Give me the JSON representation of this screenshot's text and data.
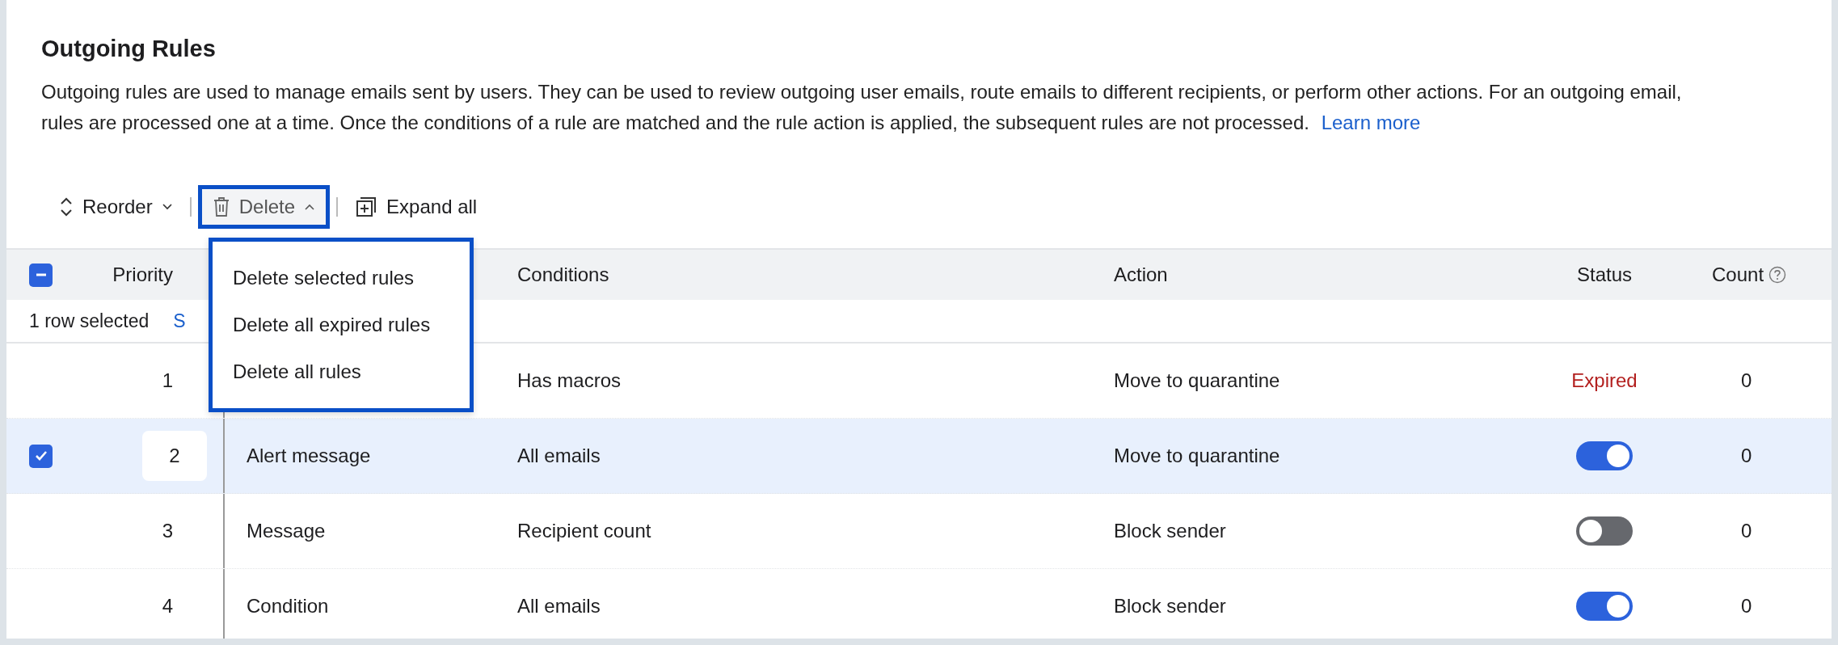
{
  "page": {
    "title": "Outgoing Rules",
    "description": "Outgoing rules are used to manage emails sent by users. They can be used to review outgoing user emails, route emails to different recipients, or perform other actions. For an outgoing email, rules are processed one at a time. Once the conditions of a rule are matched and the rule action is applied, the subsequent rules are not processed.",
    "learn_more": "Learn more"
  },
  "toolbar": {
    "reorder": "Reorder",
    "delete": {
      "label": "Delete",
      "expanded": true
    },
    "expand_all": "Expand all"
  },
  "delete_menu": {
    "items": [
      "Delete selected rules",
      "Delete all expired rules",
      "Delete all rules"
    ]
  },
  "table": {
    "select_all": {
      "indeterminate": true
    },
    "columns": [
      "Priority",
      "Conditions",
      "Action",
      "Status",
      "Count"
    ],
    "selection_bar": {
      "text": "1 row selected",
      "link": "S"
    },
    "rows": [
      {
        "priority": "1",
        "selected": false,
        "conditions": "Has macros",
        "action": "Move to quarantine",
        "status": {
          "kind": "expired",
          "text": "Expired"
        },
        "count": "0"
      },
      {
        "priority": "2",
        "selected": true,
        "name": "Alert message",
        "conditions": "All emails",
        "action": "Move to quarantine",
        "status": {
          "kind": "toggle",
          "on": true
        },
        "count": "0"
      },
      {
        "priority": "3",
        "selected": false,
        "name": "Message",
        "conditions": "Recipient count",
        "action": "Block sender",
        "status": {
          "kind": "toggle",
          "on": false
        },
        "count": "0"
      },
      {
        "priority": "4",
        "selected": false,
        "name": "Condition",
        "conditions": "All emails",
        "action": "Block sender",
        "status": {
          "kind": "toggle",
          "on": true
        },
        "count": "0"
      }
    ]
  }
}
